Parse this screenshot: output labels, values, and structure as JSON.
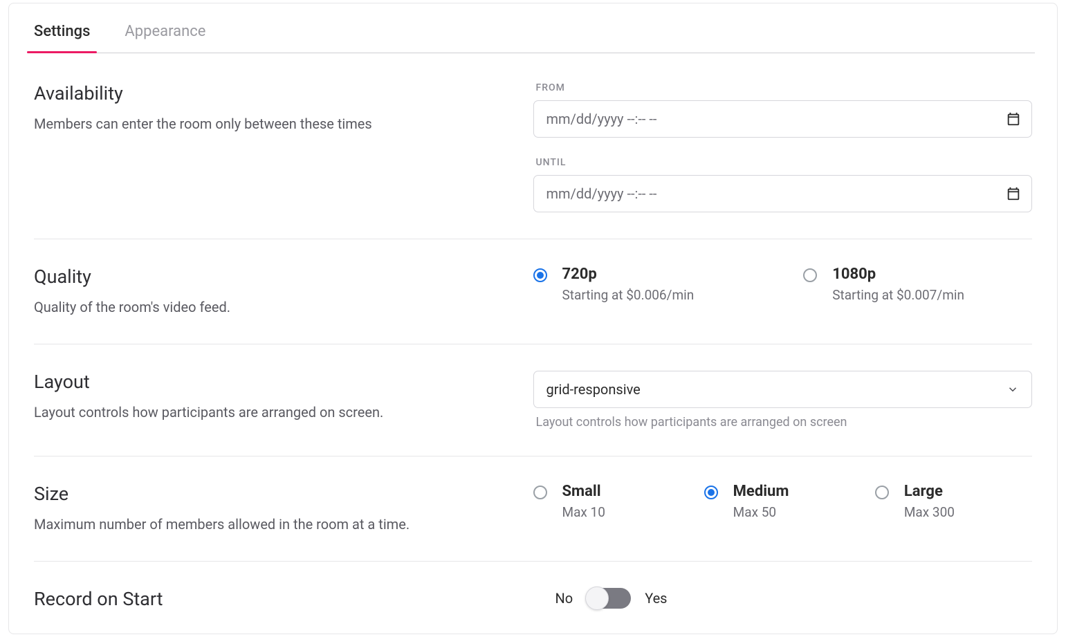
{
  "tabs": {
    "settings": "Settings",
    "appearance": "Appearance"
  },
  "availability": {
    "title": "Availability",
    "desc": "Members can enter the room only between these times",
    "from_label": "FROM",
    "until_label": "UNTIL",
    "placeholder": "mm/dd/yyyy --:-- --"
  },
  "quality": {
    "title": "Quality",
    "desc": "Quality of the room's video feed.",
    "options": [
      {
        "label": "720p",
        "sub": "Starting at $0.006/min",
        "checked": true
      },
      {
        "label": "1080p",
        "sub": "Starting at $0.007/min",
        "checked": false
      }
    ]
  },
  "layout": {
    "title": "Layout",
    "desc": "Layout controls how participants are arranged on screen.",
    "value": "grid-responsive",
    "help": "Layout controls how participants are arranged on screen"
  },
  "size": {
    "title": "Size",
    "desc": "Maximum number of members allowed in the room at a time.",
    "options": [
      {
        "label": "Small",
        "sub": "Max 10",
        "checked": false
      },
      {
        "label": "Medium",
        "sub": "Max 50",
        "checked": true
      },
      {
        "label": "Large",
        "sub": "Max 300",
        "checked": false
      }
    ]
  },
  "record": {
    "title": "Record on Start",
    "no": "No",
    "yes": "Yes",
    "value": false
  }
}
